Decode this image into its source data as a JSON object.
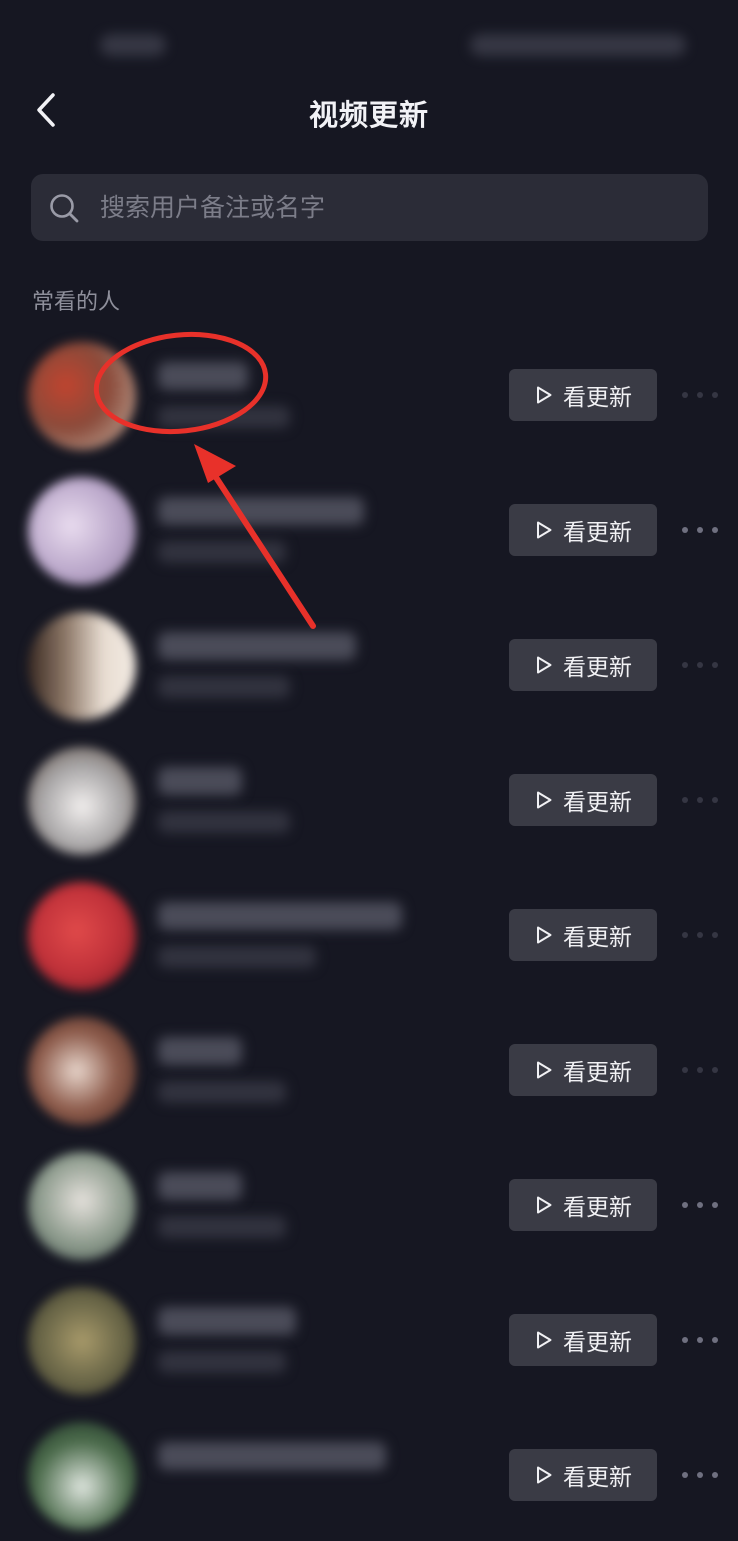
{
  "status_bar": {
    "time": "",
    "indicators": ""
  },
  "header": {
    "back_icon": "chevron-left-icon",
    "title": "视频更新"
  },
  "search": {
    "icon": "search-icon",
    "placeholder": "搜索用户备注或名字",
    "value": ""
  },
  "section": {
    "label": "常看的人"
  },
  "users": [
    {
      "avatar_color": "#8a4a3a",
      "button_label": "看更新",
      "button_icon": "play-icon",
      "more_icon": "more-dots-icon"
    },
    {
      "avatar_color": "#b9a6c9",
      "button_label": "看更新",
      "button_icon": "play-icon",
      "more_icon": "more-dots-icon"
    },
    {
      "avatar_color": "#8d7868",
      "button_label": "看更新",
      "button_icon": "play-icon",
      "more_icon": "more-dots-icon"
    },
    {
      "avatar_color": "#a9a7a8",
      "button_label": "看更新",
      "button_icon": "play-icon",
      "more_icon": "more-dots-icon"
    },
    {
      "avatar_color": "#c1323a",
      "button_label": "看更新",
      "button_icon": "play-icon",
      "more_icon": "more-dots-icon"
    },
    {
      "avatar_color": "#8c5a4a",
      "button_label": "看更新",
      "button_icon": "play-icon",
      "more_icon": "more-dots-icon"
    },
    {
      "avatar_color": "#8c9a8c",
      "button_label": "看更新",
      "button_icon": "play-icon",
      "more_icon": "more-dots-icon"
    },
    {
      "avatar_color": "#6e6a4a",
      "button_label": "看更新",
      "button_icon": "play-icon",
      "more_icon": "more-dots-icon"
    },
    {
      "avatar_color": "#4a6a4a",
      "button_label": "看更新",
      "button_icon": "play-icon",
      "more_icon": "more-dots-icon"
    }
  ],
  "annotation": {
    "color": "#e8312a",
    "shapes": [
      "highlight-circle-icon",
      "pointer-arrow-icon"
    ]
  }
}
